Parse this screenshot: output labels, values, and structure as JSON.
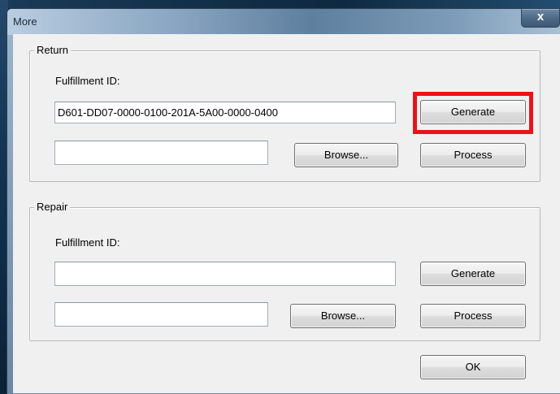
{
  "window": {
    "title": "More",
    "close_glyph": "x"
  },
  "return_group": {
    "legend": "Return",
    "fulfillment_label": "Fulfillment ID:",
    "fulfillment_value": "D601-DD07-0000-0100-201A-5A00-0000-0400",
    "generate_label": "Generate",
    "path_value": "",
    "browse_label": "Browse...",
    "process_label": "Process"
  },
  "repair_group": {
    "legend": "Repair",
    "fulfillment_label": "Fulfillment ID:",
    "fulfillment_value": "",
    "generate_label": "Generate",
    "path_value": "",
    "browse_label": "Browse...",
    "process_label": "Process"
  },
  "ok_label": "OK",
  "highlight_color": "#e8131a"
}
